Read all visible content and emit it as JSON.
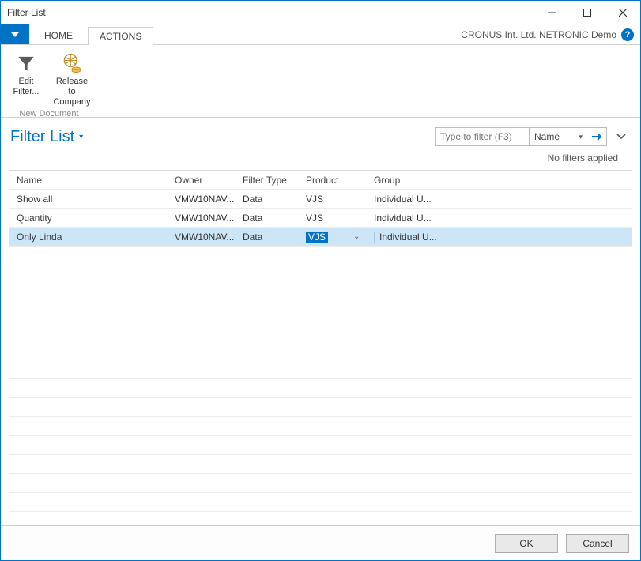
{
  "window": {
    "title": "Filter List"
  },
  "ribbon": {
    "company": "CRONUS Int. Ltd. NETRONIC Demo",
    "tabs": {
      "home": "HOME",
      "actions": "ACTIONS"
    },
    "group_label": "New Document",
    "buttons": {
      "edit_filter": "Edit\nFilter...",
      "release": "Release to\nCompany"
    }
  },
  "page": {
    "title": "Filter List",
    "filter_placeholder": "Type to filter (F3)",
    "filter_field": "Name",
    "filters_status": "No filters applied"
  },
  "grid": {
    "columns": {
      "name": "Name",
      "owner": "Owner",
      "type": "Filter Type",
      "product": "Product",
      "group": "Group"
    },
    "rows": [
      {
        "name": "Show all",
        "owner": "VMW10NAV...",
        "type": "Data",
        "product": "VJS",
        "group": "Individual U...",
        "selected": false
      },
      {
        "name": "Quantity",
        "owner": "VMW10NAV...",
        "type": "Data",
        "product": "VJS",
        "group": "Individual U...",
        "selected": false
      },
      {
        "name": "Only Linda",
        "owner": "VMW10NAV...",
        "type": "Data",
        "product": "VJS",
        "group": "Individual U...",
        "selected": true
      }
    ]
  },
  "footer": {
    "ok": "OK",
    "cancel": "Cancel"
  }
}
